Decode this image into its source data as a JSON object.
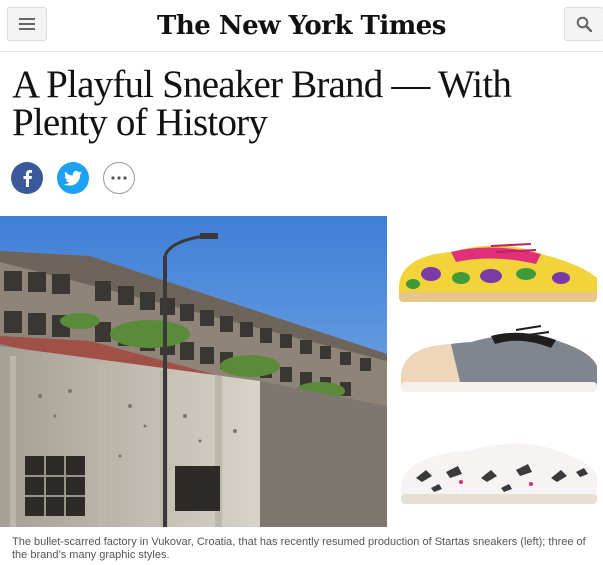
{
  "header": {
    "masthead": "The New York Times",
    "menu_icon": "hamburger-menu-icon",
    "search_icon": "search-icon"
  },
  "article": {
    "headline": "A Playful Sneaker Brand — With Plenty of History",
    "share": {
      "facebook_icon": "facebook-icon",
      "twitter_icon": "twitter-icon",
      "more_icon": "more-dots-icon"
    },
    "caption": "The bullet-scarred factory in Vukovar, Croatia, that has recently resumed production of Startas sneakers (left); three of the brand’s many graphic styles."
  },
  "colors": {
    "facebook": "#3b5998",
    "twitter": "#1da1f2",
    "header_button_bg": "#f4f4f4",
    "divider": "#e2e2e2"
  }
}
